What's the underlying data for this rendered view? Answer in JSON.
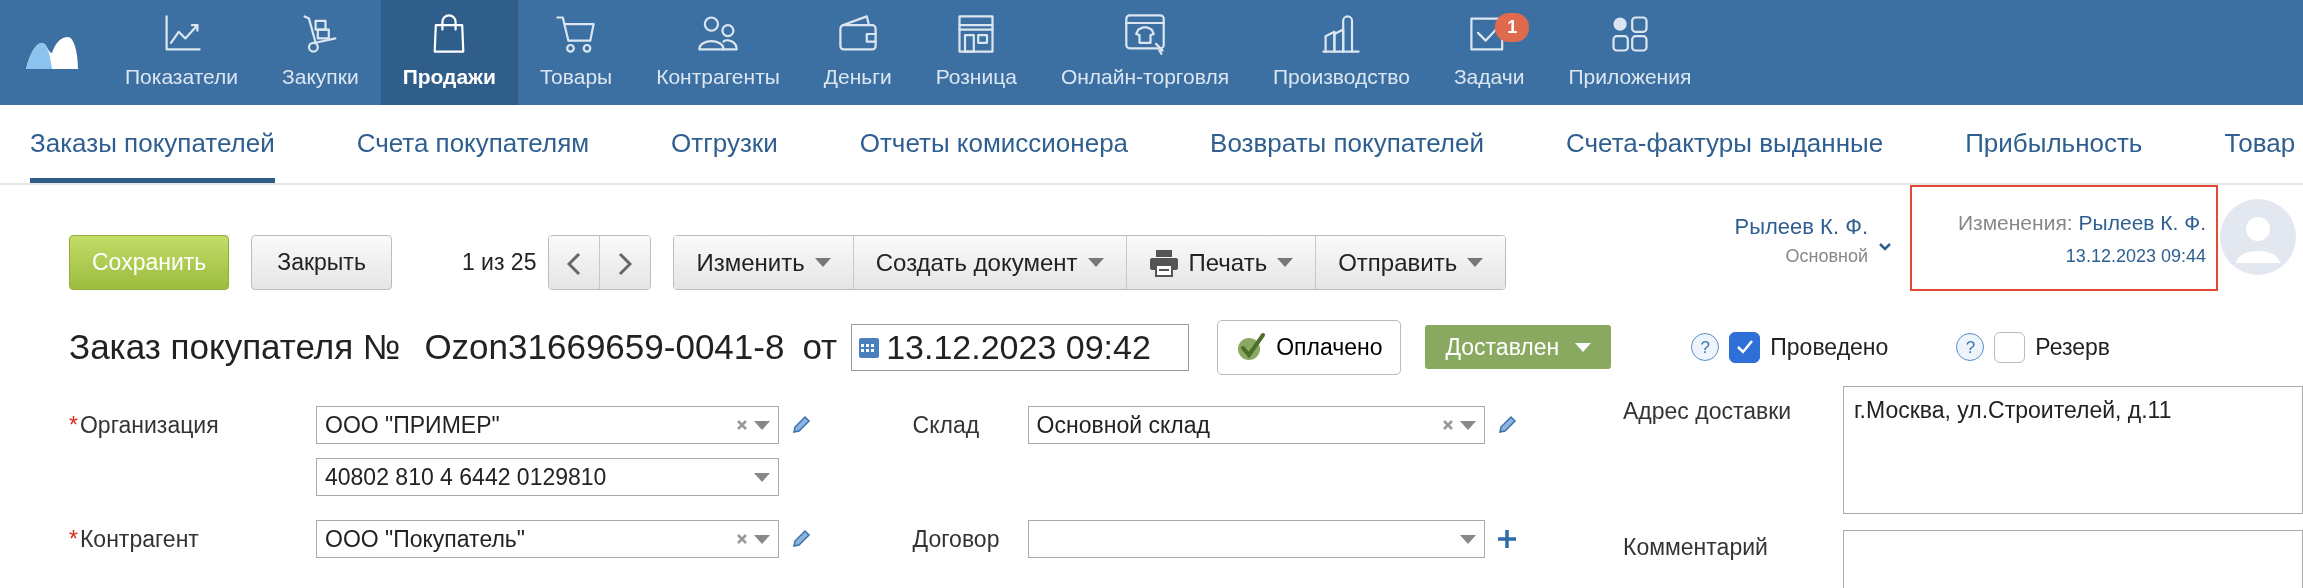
{
  "nav": {
    "items": [
      {
        "label": "Показатели",
        "selected": false
      },
      {
        "label": "Закупки",
        "selected": false
      },
      {
        "label": "Продажи",
        "selected": true
      },
      {
        "label": "Товары",
        "selected": false
      },
      {
        "label": "Контрагенты",
        "selected": false
      },
      {
        "label": "Деньги",
        "selected": false
      },
      {
        "label": "Розница",
        "selected": false
      },
      {
        "label": "Онлайн-торговля",
        "selected": false
      },
      {
        "label": "Производство",
        "selected": false
      },
      {
        "label": "Задачи",
        "selected": false,
        "badge": "1"
      },
      {
        "label": "Приложения",
        "selected": false
      }
    ]
  },
  "subnav": [
    {
      "label": "Заказы покупателей",
      "selected": true
    },
    {
      "label": "Счета покупателям",
      "selected": false
    },
    {
      "label": "Отгрузки",
      "selected": false
    },
    {
      "label": "Отчеты комиссионера",
      "selected": false
    },
    {
      "label": "Возвраты покупателей",
      "selected": false
    },
    {
      "label": "Счета-фактуры выданные",
      "selected": false
    },
    {
      "label": "Прибыльность",
      "selected": false
    },
    {
      "label": "Товар",
      "selected": false
    }
  ],
  "toolbar": {
    "save": "Сохранить",
    "close": "Закрыть",
    "pager": "1 из 25",
    "menus": [
      {
        "label": "Изменить",
        "kind": "plain"
      },
      {
        "label": "Создать документ",
        "kind": "plain"
      },
      {
        "label": "Печать",
        "kind": "print"
      },
      {
        "label": "Отправить",
        "kind": "plain"
      }
    ]
  },
  "user": {
    "name": "Рылеев К. Ф.",
    "role": "Основной"
  },
  "changes": {
    "label": "Изменения:",
    "author": "Рылеев К. Ф.",
    "time": "13.12.2023 09:44"
  },
  "document": {
    "title": "Заказ покупателя №",
    "number": "Ozon31669659-0041-8",
    "from": "от",
    "date": "13.12.2023 09:42"
  },
  "status": {
    "paid": "Оплачено",
    "state": "Доставлен",
    "checks": [
      {
        "help": "?",
        "label": "Проведено",
        "checked": true
      },
      {
        "help": "?",
        "label": "Резерв",
        "checked": false
      }
    ]
  },
  "form": {
    "column_1": [
      {
        "required_mark": "*",
        "label": "Организация",
        "value": "ООО \"ПРИМЕР\"",
        "clearable": true,
        "kind": "edit"
      },
      {
        "value": "40802 810 4 6442 0129810",
        "clearable": false,
        "kind": "plain"
      },
      {
        "required_mark": "*",
        "label": "Контрагент",
        "value": "ООО \"Покупатель\"",
        "clearable": true,
        "kind": "edit"
      }
    ],
    "column_2": [
      {
        "label": "Склад",
        "value": "Основной склад",
        "clearable": true,
        "kind": "edit"
      },
      {
        "label": "Договор",
        "clearable": false,
        "kind": "add"
      }
    ],
    "column_3": [
      {
        "label": "Адрес доставки",
        "value": "г.Москва, ул.Строителей, д.11"
      },
      {
        "label": "Комментарий"
      }
    ]
  }
}
